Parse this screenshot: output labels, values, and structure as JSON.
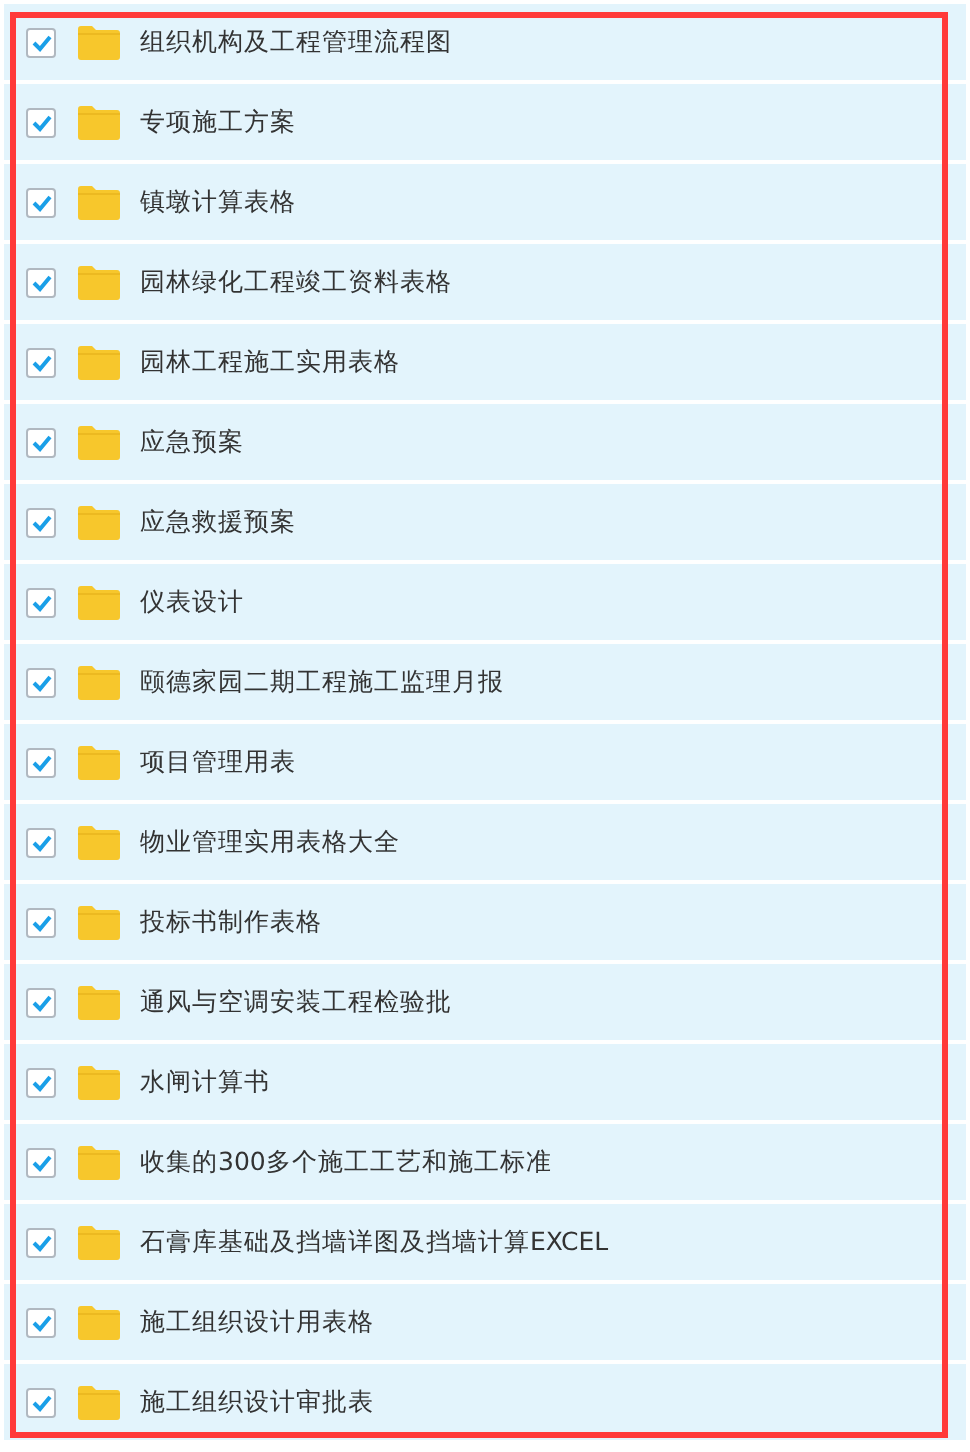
{
  "folders": [
    {
      "name": "组织机构及工程管理流程图",
      "checked": true
    },
    {
      "name": "专项施工方案",
      "checked": true
    },
    {
      "name": "镇墩计算表格",
      "checked": true
    },
    {
      "name": "园林绿化工程竣工资料表格",
      "checked": true
    },
    {
      "name": "园林工程施工实用表格",
      "checked": true
    },
    {
      "name": "应急预案",
      "checked": true
    },
    {
      "name": "应急救援预案",
      "checked": true
    },
    {
      "name": "仪表设计",
      "checked": true
    },
    {
      "name": "颐德家园二期工程施工监理月报",
      "checked": true
    },
    {
      "name": "项目管理用表",
      "checked": true
    },
    {
      "name": "物业管理实用表格大全",
      "checked": true
    },
    {
      "name": "投标书制作表格",
      "checked": true
    },
    {
      "name": "通风与空调安装工程检验批",
      "checked": true
    },
    {
      "name": "水闸计算书",
      "checked": true
    },
    {
      "name": "收集的300多个施工工艺和施工标准",
      "checked": true
    },
    {
      "name": "石膏库基础及挡墙详图及挡墙计算EXCEL",
      "checked": true
    },
    {
      "name": "施工组织设计用表格",
      "checked": true
    },
    {
      "name": "施工组织设计审批表",
      "checked": true
    }
  ]
}
